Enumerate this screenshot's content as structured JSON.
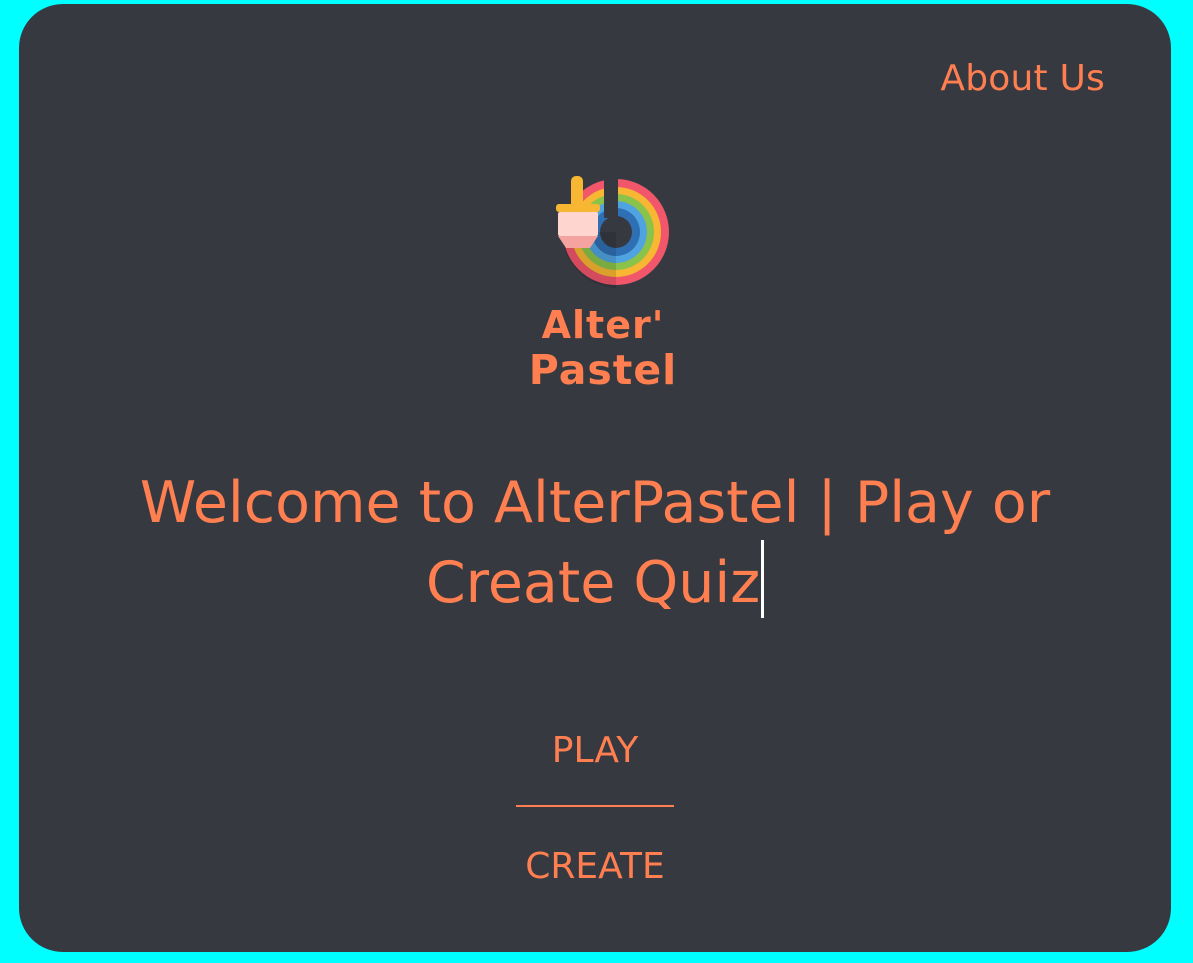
{
  "nav": {
    "about_label": "About Us"
  },
  "logo": {
    "line1": "Alter'",
    "line2": "Pastel",
    "icon": "paintbrush-rainbow-icon"
  },
  "headline": {
    "text": "Welcome to AlterPastel | Play or Create Quiz"
  },
  "actions": {
    "play_label": "PLAY",
    "create_label": "CREATE"
  },
  "colors": {
    "page_background": "#00ffff",
    "card_background": "#363940",
    "accent": "#ff7f50",
    "cursor": "#ffffff"
  }
}
